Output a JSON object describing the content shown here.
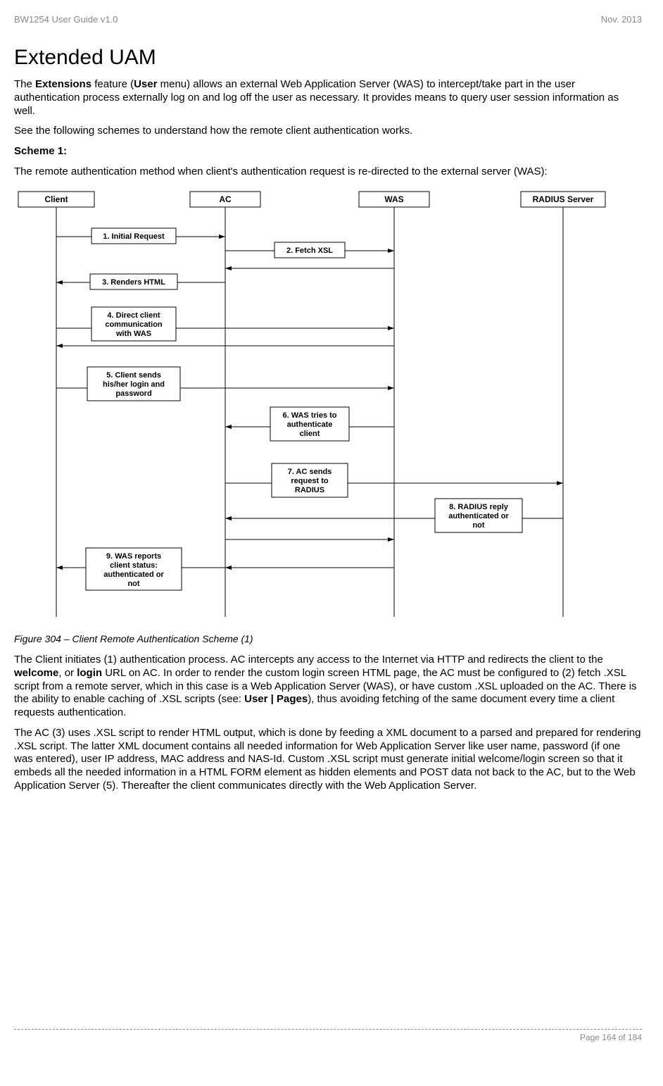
{
  "header": {
    "left": "BW1254 User Guide v1.0",
    "right": "Nov.  2013"
  },
  "title": "Extended UAM",
  "p1_parts": {
    "a": "The ",
    "b": "Extensions",
    "c": " feature (",
    "d": "User",
    "e": " menu) allows an external Web Application Server (WAS) to intercept/take part in the user authentication process externally log on and log off the user as necessary. It provides means to query user session information as well."
  },
  "p2": "See the following schemes to understand how the remote client authentication works.",
  "scheme_label": "Scheme 1:",
  "p3": "The remote authentication method when client's authentication request is re-directed to the external server (WAS):",
  "diagram": {
    "actors": {
      "client": "Client",
      "ac": "AC",
      "was": "WAS",
      "radius": "RADIUS Server"
    },
    "steps": {
      "s1": "1. Initial Request",
      "s2": "2. Fetch XSL",
      "s3": "3. Renders HTML",
      "s4": "4. Direct client communication with WAS",
      "s5": "5. Client sends his/her login and password",
      "s6": "6. WAS tries to authenticate client",
      "s7": "7. AC sends request to RADIUS",
      "s8": "8. RADIUS reply authenticated or not",
      "s9": "9. WAS reports client status: authenticated or not"
    }
  },
  "figure_caption": "Figure 304  – Client Remote Authentication Scheme (1)",
  "p4_parts": {
    "a": "The Client initiates (1) authentication process. AC intercepts any access to the Internet via HTTP and redirects the client to the ",
    "b": "welcome",
    "c": ", or ",
    "d": "login",
    "e": " URL on AC. In order to render the custom login screen HTML page, the AC must be configured to (2) fetch .XSL script from a remote server, which in this case is a Web Application Server (WAS), or have custom .XSL uploaded on the AC. There is the ability to enable caching of .XSL scripts (see: ",
    "f": "User | Pages",
    "g": "), thus avoiding fetching of the same document every time a client requests authentication."
  },
  "p5": "The AC (3) uses .XSL script to render HTML output, which is done by feeding a XML document to a parsed and prepared for rendering .XSL script. The latter XML document contains all needed information for Web Application Server like user name, password (if one was entered), user IP address, MAC address and NAS-Id. Custom .XSL script must generate initial welcome/login screen so that it embeds all the needed information in a HTML FORM element as hidden elements and POST data not back to the AC, but to the Web Application Server (5). Thereafter the client communicates directly with the Web Application Server.",
  "footer": {
    "page": "Page 164 of 184"
  }
}
